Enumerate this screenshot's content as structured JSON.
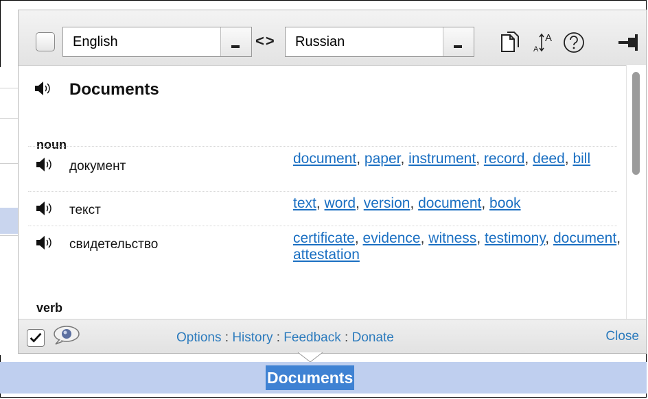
{
  "toolbar": {
    "source_language": "English",
    "target_language": "Russian",
    "swap_label": "<>"
  },
  "entry": {
    "headword": "Documents",
    "sections": [
      {
        "pos": "noun",
        "rows": [
          {
            "word": "документ",
            "synonyms": [
              "document",
              "paper",
              "instrument",
              "record",
              "deed",
              "bill"
            ]
          },
          {
            "word": "текст",
            "synonyms": [
              "text",
              "word",
              "version",
              "document",
              "book"
            ]
          },
          {
            "word": "свидетельство",
            "synonyms": [
              "certificate",
              "evidence",
              "witness",
              "testimony",
              "document",
              "attestation"
            ]
          }
        ]
      },
      {
        "pos": "verb",
        "rows": []
      }
    ]
  },
  "footer": {
    "links": [
      "Options",
      "History",
      "Feedback",
      "Donate"
    ],
    "separator": ":",
    "close": "Close"
  },
  "selection": {
    "text": "Documents"
  },
  "colors": {
    "link": "#1a6fc2",
    "selection_bg": "#bfcfef",
    "selection_highlight": "#3f82d3"
  }
}
